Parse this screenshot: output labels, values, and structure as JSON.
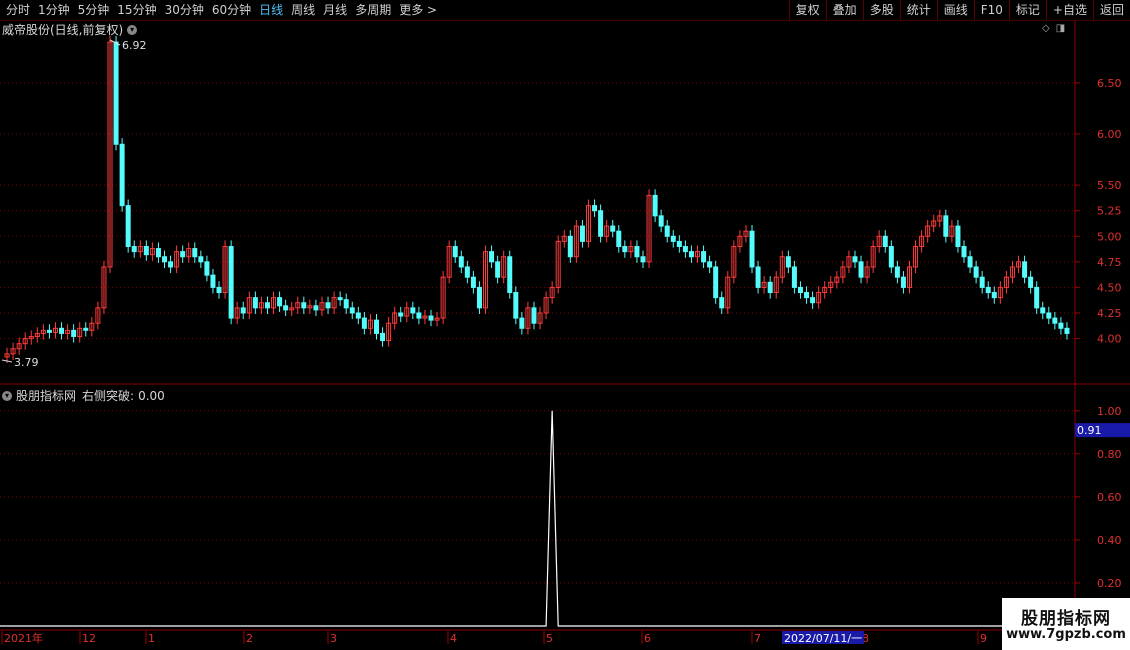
{
  "toolbar": {
    "periods": [
      "分时",
      "1分钟",
      "5分钟",
      "15分钟",
      "30分钟",
      "60分钟",
      "日线",
      "周线",
      "月线",
      "多周期",
      "更多"
    ],
    "active_index": 6,
    "more_arrow": ">",
    "buttons": [
      "复权",
      "叠加",
      "多股",
      "统计",
      "画线",
      "F10",
      "标记",
      "+自选",
      "返回"
    ]
  },
  "price_panel": {
    "title": "威帝股份(日线,前复权)",
    "high_label": "6.92",
    "low_label": "3.79",
    "y_ticks": [
      "6.50",
      "6.00",
      "5.50",
      "5.25",
      "5.00",
      "4.75",
      "4.50",
      "4.25",
      "4.00"
    ]
  },
  "indicator_panel": {
    "title": "股朋指标网",
    "series_label": "右侧突破:",
    "series_value": "0.00",
    "current_value_box": "0.91",
    "y_ticks": [
      "1.00",
      "0.80",
      "0.60",
      "0.40",
      "0.20"
    ]
  },
  "time_axis": {
    "labels": [
      "2021年",
      "12",
      "1",
      "2",
      "3",
      "4",
      "5",
      "6",
      "7",
      "8",
      "9"
    ],
    "cursor_date": "2022/07/11/一"
  },
  "watermark": {
    "title": "股朋指标网",
    "url": "www.7gpzb.com"
  },
  "chart_data": {
    "type": "candlestick",
    "up_color": "#ff3b3b",
    "down_color": "#54fcfc",
    "high": 6.92,
    "low": 3.79,
    "closes": [
      3.85,
      3.9,
      3.95,
      4.0,
      4.02,
      4.05,
      4.08,
      4.06,
      4.1,
      4.05,
      4.08,
      4.02,
      4.1,
      4.08,
      4.15,
      4.3,
      4.7,
      6.9,
      5.9,
      5.3,
      4.9,
      4.85,
      4.9,
      4.82,
      4.88,
      4.8,
      4.75,
      4.7,
      4.85,
      4.8,
      4.88,
      4.8,
      4.75,
      4.62,
      4.5,
      4.45,
      4.9,
      4.2,
      4.3,
      4.25,
      4.4,
      4.3,
      4.35,
      4.3,
      4.4,
      4.32,
      4.28,
      4.3,
      4.35,
      4.3,
      4.32,
      4.28,
      4.35,
      4.3,
      4.4,
      4.38,
      4.3,
      4.25,
      4.2,
      4.1,
      4.18,
      4.05,
      3.98,
      4.15,
      4.25,
      4.22,
      4.3,
      4.25,
      4.2,
      4.22,
      4.18,
      4.2,
      4.6,
      4.9,
      4.8,
      4.7,
      4.6,
      4.5,
      4.3,
      4.85,
      4.75,
      4.6,
      4.8,
      4.45,
      4.2,
      4.1,
      4.3,
      4.15,
      4.25,
      4.4,
      4.5,
      4.95,
      5.0,
      4.8,
      5.1,
      4.95,
      5.3,
      5.25,
      5.0,
      5.1,
      5.05,
      4.9,
      4.85,
      4.9,
      4.8,
      4.75,
      5.4,
      5.2,
      5.1,
      5.0,
      4.95,
      4.9,
      4.85,
      4.8,
      4.85,
      4.75,
      4.7,
      4.4,
      4.3,
      4.6,
      4.9,
      5.0,
      5.05,
      4.7,
      4.5,
      4.55,
      4.45,
      4.6,
      4.8,
      4.7,
      4.5,
      4.45,
      4.4,
      4.35,
      4.45,
      4.5,
      4.55,
      4.6,
      4.7,
      4.8,
      4.75,
      4.6,
      4.7,
      4.9,
      5.0,
      4.9,
      4.7,
      4.6,
      4.5,
      4.7,
      4.9,
      5.0,
      5.1,
      5.15,
      5.2,
      5.0,
      5.1,
      4.9,
      4.8,
      4.7,
      4.6,
      4.5,
      4.45,
      4.4,
      4.5,
      4.6,
      4.7,
      4.75,
      4.6,
      4.5,
      4.3,
      4.25,
      4.2,
      4.15,
      4.1,
      4.05
    ],
    "indicator": {
      "name": "右侧突破",
      "values_nonzero": [
        {
          "index": 90,
          "value": 1.0
        }
      ],
      "base": 0.0
    },
    "price_ylim": [
      3.79,
      6.92
    ],
    "indicator_ylim": [
      0,
      1.05
    ]
  }
}
